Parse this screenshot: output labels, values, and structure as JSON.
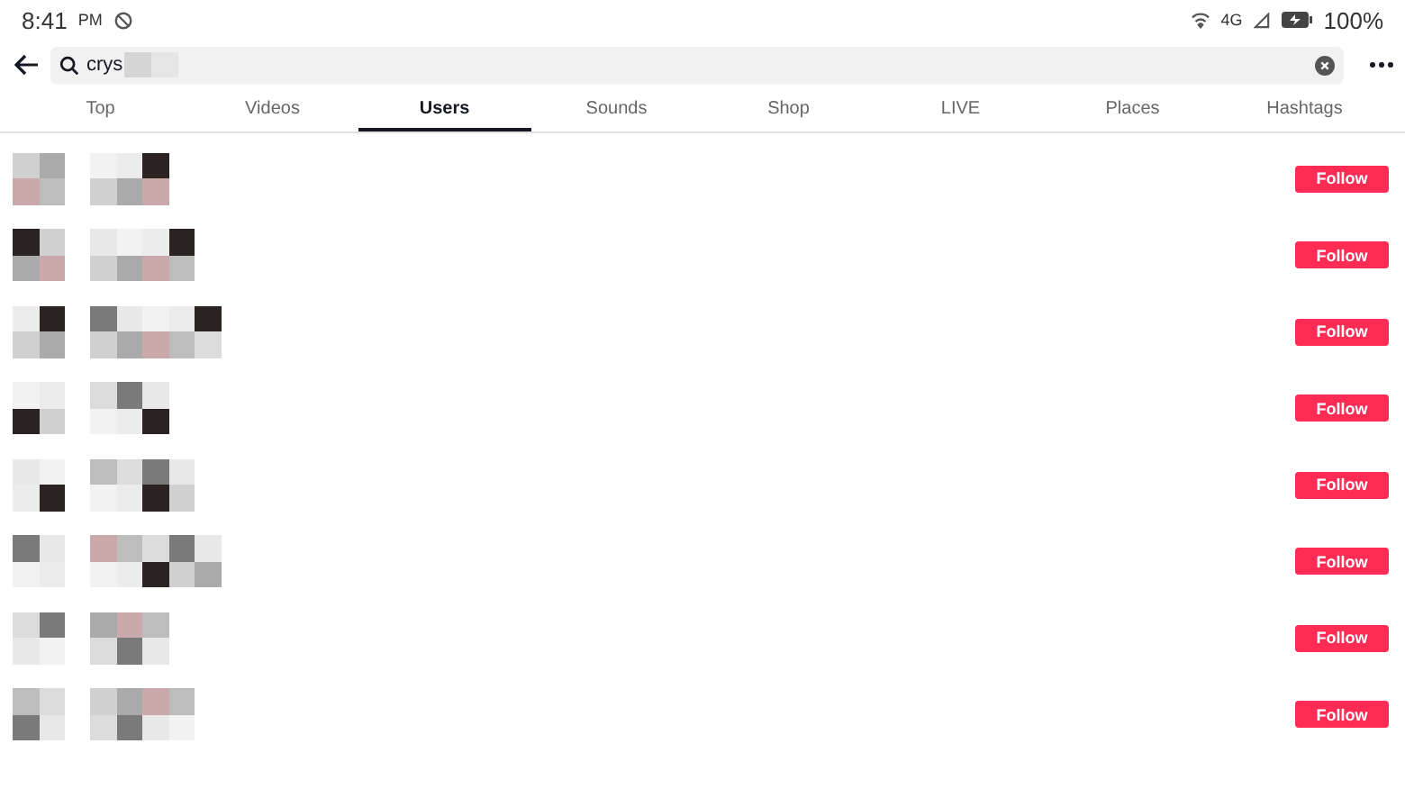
{
  "status_bar": {
    "time": "8:41",
    "ampm": "PM",
    "network": "4G",
    "battery": "100%"
  },
  "search": {
    "value": "crys"
  },
  "tabs": [
    {
      "label": "Top",
      "selected": false
    },
    {
      "label": "Videos",
      "selected": false
    },
    {
      "label": "Users",
      "selected": true
    },
    {
      "label": "Sounds",
      "selected": false
    },
    {
      "label": "Shop",
      "selected": false
    },
    {
      "label": "LIVE",
      "selected": false
    },
    {
      "label": "Places",
      "selected": false
    },
    {
      "label": "Hashtags",
      "selected": false
    }
  ],
  "users": [
    {
      "button": "Follow"
    },
    {
      "button": "Follow"
    },
    {
      "button": "Follow"
    },
    {
      "button": "Follow"
    },
    {
      "button": "Follow"
    },
    {
      "button": "Follow"
    },
    {
      "button": "Follow"
    },
    {
      "button": "Follow"
    }
  ]
}
